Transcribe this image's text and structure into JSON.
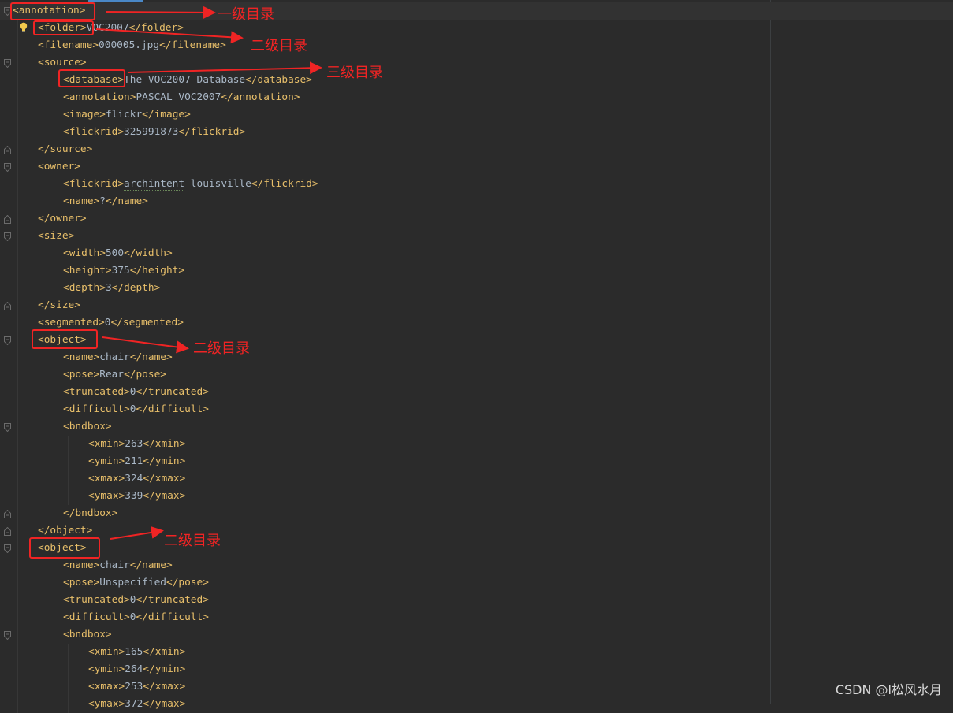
{
  "editor": {
    "language": "xml",
    "lines": [
      {
        "indent": 0,
        "segments": [
          {
            "t": "tag",
            "v": "<annotation>"
          }
        ]
      },
      {
        "indent": 1,
        "segments": [
          {
            "t": "tag",
            "v": "<folder>"
          },
          {
            "t": "txt",
            "v": "VOC2007"
          },
          {
            "t": "tag",
            "v": "</folder>"
          }
        ]
      },
      {
        "indent": 1,
        "segments": [
          {
            "t": "tag",
            "v": "<filename>"
          },
          {
            "t": "txt",
            "v": "000005.jpg"
          },
          {
            "t": "tag",
            "v": "</filename>"
          }
        ]
      },
      {
        "indent": 1,
        "segments": [
          {
            "t": "tag",
            "v": "<source>"
          }
        ]
      },
      {
        "indent": 2,
        "segments": [
          {
            "t": "tag",
            "v": "<database>"
          },
          {
            "t": "txt",
            "v": "The VOC2007 Database"
          },
          {
            "t": "tag",
            "v": "</database>"
          }
        ]
      },
      {
        "indent": 2,
        "segments": [
          {
            "t": "tag",
            "v": "<annotation>"
          },
          {
            "t": "txt",
            "v": "PASCAL VOC2007"
          },
          {
            "t": "tag",
            "v": "</annotation>"
          }
        ]
      },
      {
        "indent": 2,
        "segments": [
          {
            "t": "tag",
            "v": "<image>"
          },
          {
            "t": "txt",
            "v": "flickr"
          },
          {
            "t": "tag",
            "v": "</image>"
          }
        ]
      },
      {
        "indent": 2,
        "segments": [
          {
            "t": "tag",
            "v": "<flickrid>"
          },
          {
            "t": "txt",
            "v": "325991873"
          },
          {
            "t": "tag",
            "v": "</flickrid>"
          }
        ]
      },
      {
        "indent": 1,
        "segments": [
          {
            "t": "tag",
            "v": "</source>"
          }
        ]
      },
      {
        "indent": 1,
        "segments": [
          {
            "t": "tag",
            "v": "<owner>"
          }
        ]
      },
      {
        "indent": 2,
        "segments": [
          {
            "t": "tag",
            "v": "<flickrid>"
          },
          {
            "t": "typo",
            "v": "archintent"
          },
          {
            "t": "txt",
            "v": " louisville"
          },
          {
            "t": "tag",
            "v": "</flickrid>"
          }
        ]
      },
      {
        "indent": 2,
        "segments": [
          {
            "t": "tag",
            "v": "<name>"
          },
          {
            "t": "txt",
            "v": "?"
          },
          {
            "t": "tag",
            "v": "</name>"
          }
        ]
      },
      {
        "indent": 1,
        "segments": [
          {
            "t": "tag",
            "v": "</owner>"
          }
        ]
      },
      {
        "indent": 1,
        "segments": [
          {
            "t": "tag",
            "v": "<size>"
          }
        ]
      },
      {
        "indent": 2,
        "segments": [
          {
            "t": "tag",
            "v": "<width>"
          },
          {
            "t": "txt",
            "v": "500"
          },
          {
            "t": "tag",
            "v": "</width>"
          }
        ]
      },
      {
        "indent": 2,
        "segments": [
          {
            "t": "tag",
            "v": "<height>"
          },
          {
            "t": "txt",
            "v": "375"
          },
          {
            "t": "tag",
            "v": "</height>"
          }
        ]
      },
      {
        "indent": 2,
        "segments": [
          {
            "t": "tag",
            "v": "<depth>"
          },
          {
            "t": "txt",
            "v": "3"
          },
          {
            "t": "tag",
            "v": "</depth>"
          }
        ]
      },
      {
        "indent": 1,
        "segments": [
          {
            "t": "tag",
            "v": "</size>"
          }
        ]
      },
      {
        "indent": 1,
        "segments": [
          {
            "t": "tag",
            "v": "<segmented>"
          },
          {
            "t": "txt",
            "v": "0"
          },
          {
            "t": "tag",
            "v": "</segmented>"
          }
        ]
      },
      {
        "indent": 1,
        "segments": [
          {
            "t": "tag",
            "v": "<object>"
          }
        ]
      },
      {
        "indent": 2,
        "segments": [
          {
            "t": "tag",
            "v": "<name>"
          },
          {
            "t": "txt",
            "v": "chair"
          },
          {
            "t": "tag",
            "v": "</name>"
          }
        ]
      },
      {
        "indent": 2,
        "segments": [
          {
            "t": "tag",
            "v": "<pose>"
          },
          {
            "t": "txt",
            "v": "Rear"
          },
          {
            "t": "tag",
            "v": "</pose>"
          }
        ]
      },
      {
        "indent": 2,
        "segments": [
          {
            "t": "tag",
            "v": "<truncated>"
          },
          {
            "t": "txt",
            "v": "0"
          },
          {
            "t": "tag",
            "v": "</truncated>"
          }
        ]
      },
      {
        "indent": 2,
        "segments": [
          {
            "t": "tag",
            "v": "<difficult>"
          },
          {
            "t": "txt",
            "v": "0"
          },
          {
            "t": "tag",
            "v": "</difficult>"
          }
        ]
      },
      {
        "indent": 2,
        "segments": [
          {
            "t": "tag",
            "v": "<bndbox>"
          }
        ]
      },
      {
        "indent": 3,
        "segments": [
          {
            "t": "tag",
            "v": "<xmin>"
          },
          {
            "t": "txt",
            "v": "263"
          },
          {
            "t": "tag",
            "v": "</xmin>"
          }
        ]
      },
      {
        "indent": 3,
        "segments": [
          {
            "t": "tag",
            "v": "<ymin>"
          },
          {
            "t": "txt",
            "v": "211"
          },
          {
            "t": "tag",
            "v": "</ymin>"
          }
        ]
      },
      {
        "indent": 3,
        "segments": [
          {
            "t": "tag",
            "v": "<xmax>"
          },
          {
            "t": "txt",
            "v": "324"
          },
          {
            "t": "tag",
            "v": "</xmax>"
          }
        ]
      },
      {
        "indent": 3,
        "segments": [
          {
            "t": "tag",
            "v": "<ymax>"
          },
          {
            "t": "txt",
            "v": "339"
          },
          {
            "t": "tag",
            "v": "</ymax>"
          }
        ]
      },
      {
        "indent": 2,
        "segments": [
          {
            "t": "tag",
            "v": "</bndbox>"
          }
        ]
      },
      {
        "indent": 1,
        "segments": [
          {
            "t": "tag",
            "v": "</object>"
          }
        ]
      },
      {
        "indent": 1,
        "segments": [
          {
            "t": "tag",
            "v": "<object>"
          }
        ]
      },
      {
        "indent": 2,
        "segments": [
          {
            "t": "tag",
            "v": "<name>"
          },
          {
            "t": "txt",
            "v": "chair"
          },
          {
            "t": "tag",
            "v": "</name>"
          }
        ]
      },
      {
        "indent": 2,
        "segments": [
          {
            "t": "tag",
            "v": "<pose>"
          },
          {
            "t": "txt",
            "v": "Unspecified"
          },
          {
            "t": "tag",
            "v": "</pose>"
          }
        ]
      },
      {
        "indent": 2,
        "segments": [
          {
            "t": "tag",
            "v": "<truncated>"
          },
          {
            "t": "txt",
            "v": "0"
          },
          {
            "t": "tag",
            "v": "</truncated>"
          }
        ]
      },
      {
        "indent": 2,
        "segments": [
          {
            "t": "tag",
            "v": "<difficult>"
          },
          {
            "t": "txt",
            "v": "0"
          },
          {
            "t": "tag",
            "v": "</difficult>"
          }
        ]
      },
      {
        "indent": 2,
        "segments": [
          {
            "t": "tag",
            "v": "<bndbox>"
          }
        ]
      },
      {
        "indent": 3,
        "segments": [
          {
            "t": "tag",
            "v": "<xmin>"
          },
          {
            "t": "txt",
            "v": "165"
          },
          {
            "t": "tag",
            "v": "</xmin>"
          }
        ]
      },
      {
        "indent": 3,
        "segments": [
          {
            "t": "tag",
            "v": "<ymin>"
          },
          {
            "t": "txt",
            "v": "264"
          },
          {
            "t": "tag",
            "v": "</ymin>"
          }
        ]
      },
      {
        "indent": 3,
        "segments": [
          {
            "t": "tag",
            "v": "<xmax>"
          },
          {
            "t": "txt",
            "v": "253"
          },
          {
            "t": "tag",
            "v": "</xmax>"
          }
        ]
      },
      {
        "indent": 3,
        "segments": [
          {
            "t": "tag",
            "v": "<ymax>"
          },
          {
            "t": "txt",
            "v": "372"
          },
          {
            "t": "tag",
            "v": "</ymax>"
          }
        ]
      }
    ],
    "fold_markers": [
      {
        "line": 0,
        "kind": "open"
      },
      {
        "line": 3,
        "kind": "open"
      },
      {
        "line": 8,
        "kind": "close"
      },
      {
        "line": 9,
        "kind": "open"
      },
      {
        "line": 12,
        "kind": "close"
      },
      {
        "line": 13,
        "kind": "open"
      },
      {
        "line": 17,
        "kind": "close"
      },
      {
        "line": 19,
        "kind": "open"
      },
      {
        "line": 24,
        "kind": "open"
      },
      {
        "line": 29,
        "kind": "close"
      },
      {
        "line": 30,
        "kind": "close"
      },
      {
        "line": 31,
        "kind": "open"
      },
      {
        "line": 36,
        "kind": "open"
      }
    ],
    "current_line": 0,
    "intention_icon_line": 1
  },
  "annotations": [
    {
      "label": "一级目录",
      "target_line": 0
    },
    {
      "label": "二级目录",
      "target_line": 1
    },
    {
      "label": "三级目录",
      "target_line": 4
    },
    {
      "label": "二级目录",
      "target_line": 19
    },
    {
      "label": "二级目录",
      "target_line": 31
    }
  ],
  "watermark": "CSDN @l松风水月",
  "colors": {
    "background": "#2b2b2b",
    "tag": "#e8bf6a",
    "text": "#a9b7c6",
    "annotation": "#f02424",
    "current_line": "#323232"
  }
}
